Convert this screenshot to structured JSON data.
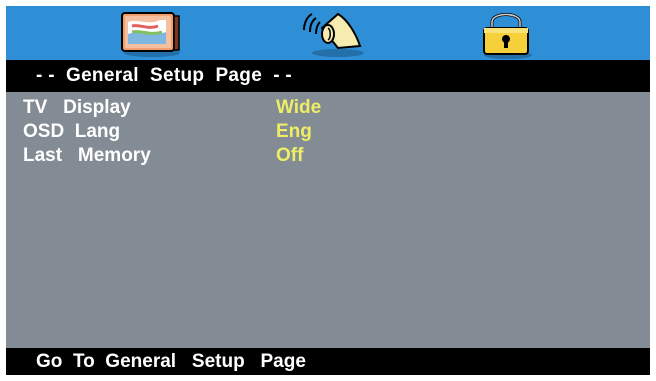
{
  "tabs": [
    {
      "icon": "tv-display-icon",
      "active": true
    },
    {
      "icon": "speaker-audio-icon",
      "active": false
    },
    {
      "icon": "padlock-icon",
      "active": false
    }
  ],
  "title": "- -  General  Setup  Page  - -",
  "settings": [
    {
      "label": "TV   Display",
      "value": "Wide"
    },
    {
      "label": "OSD  Lang",
      "value": "Eng"
    },
    {
      "label": "Last   Memory",
      "value": "Off"
    }
  ],
  "status": "Go  To  General   Setup   Page",
  "colors": {
    "tab_bar": "#2f8fd6",
    "panel": "#838b94",
    "bars": "#000000",
    "label_text": "#ffffff",
    "value_text": "#eeee66"
  }
}
